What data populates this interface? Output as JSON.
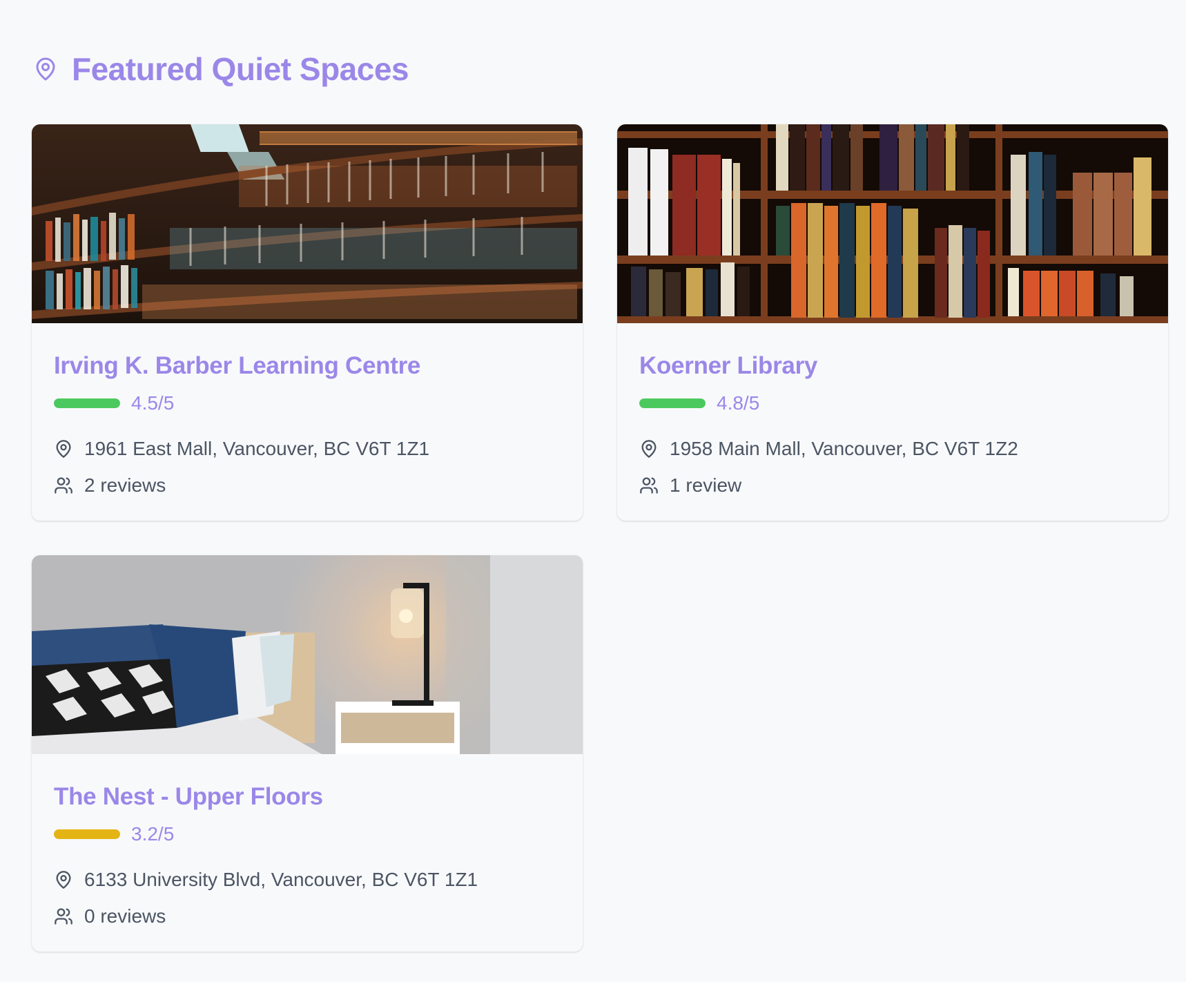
{
  "theme": {
    "accent": "#9b87e8",
    "rating_high": "#4cc95e",
    "rating_mid": "#e4b414",
    "text_muted": "#4b5563",
    "background": "#f8f9fb"
  },
  "header": {
    "icon": "map-pin-icon",
    "title": "Featured Quiet Spaces"
  },
  "spaces": [
    {
      "name": "Irving K. Barber Learning Centre",
      "image": "library-bookshelves-photo",
      "rating": 4.5,
      "rating_max": 5,
      "rating_label": "4.5/5",
      "rating_color": "#4cc95e",
      "address": "1961 East Mall, Vancouver, BC V6T 1Z1",
      "reviews_label": "2 reviews",
      "address_icon": "map-pin-icon",
      "reviews_icon": "users-icon"
    },
    {
      "name": "Koerner Library",
      "image": "bookshelf-closeup-photo",
      "rating": 4.8,
      "rating_max": 5,
      "rating_label": "4.8/5",
      "rating_color": "#4cc95e",
      "address": "1958 Main Mall, Vancouver, BC V6T 1Z2",
      "reviews_label": "1 review",
      "address_icon": "map-pin-icon",
      "reviews_icon": "users-icon"
    },
    {
      "name": "The Nest - Upper Floors",
      "image": "bedroom-lamp-photo",
      "rating": 3.2,
      "rating_max": 5,
      "rating_label": "3.2/5",
      "rating_color": "#e4b414",
      "address": "6133 University Blvd, Vancouver, BC V6T 1Z1",
      "reviews_label": "0 reviews",
      "address_icon": "map-pin-icon",
      "reviews_icon": "users-icon"
    }
  ]
}
